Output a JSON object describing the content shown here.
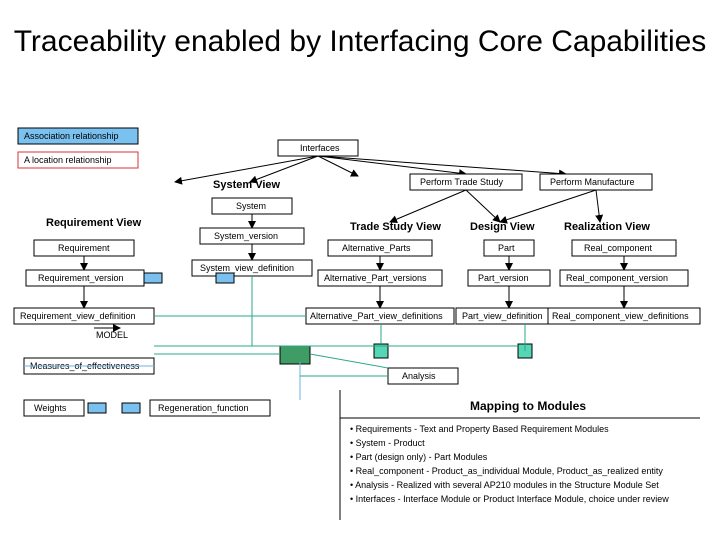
{
  "title": "Traceability enabled by Interfacing Core Capabilities",
  "legend": {
    "assoc": "Association relationship",
    "locate": "A location relationship",
    "arrow": "MODEL"
  },
  "headers": {
    "systemView": "System View",
    "reqView": "Requirement View",
    "tradeView": "Trade Study View",
    "designView": "Design View",
    "realView": "Realization View"
  },
  "topActions": {
    "tradeStudy": "Perform Trade Study",
    "manufacture": "Perform Manufacture"
  },
  "boxes": {
    "interfaces": "Interfaces",
    "system": "System",
    "systemVersion": "System_version",
    "systemViewDef": "System_view_definition",
    "requirement": "Requirement",
    "requirementVersion": "Requirement_version",
    "requirementViewDef": "Requirement_view_definition",
    "measures": "Measures_of_effectiveness",
    "weights": "Weights",
    "regenFunc": "Regeneration_function",
    "altParts": "Alternative_Parts",
    "altPartVersions": "Alternative_Part_versions",
    "altPartViewDefs": "Alternative_Part_view_definitions",
    "part": "Part",
    "partVersion": "Part_version",
    "partViewDef": "Part_view_definition",
    "realComponent": "Real_component",
    "realComponentVersion": "Real_component_version",
    "realComponentViewDefs": "Real_component_view_definitions",
    "analysis": "Analysis"
  },
  "mapping": {
    "title": "Mapping to Modules",
    "lines": [
      "• Requirements - Text and Property Based Requirement Modules",
      "• System - Product",
      "• Part (design only) - Part Modules",
      "• Real_component - Product_as_individual Module, Product_as_realized entity",
      "• Analysis - Realized with several AP210 modules in the Structure Module Set",
      "• Interfaces - Interface Module or Product Interface Module, choice under review"
    ]
  }
}
